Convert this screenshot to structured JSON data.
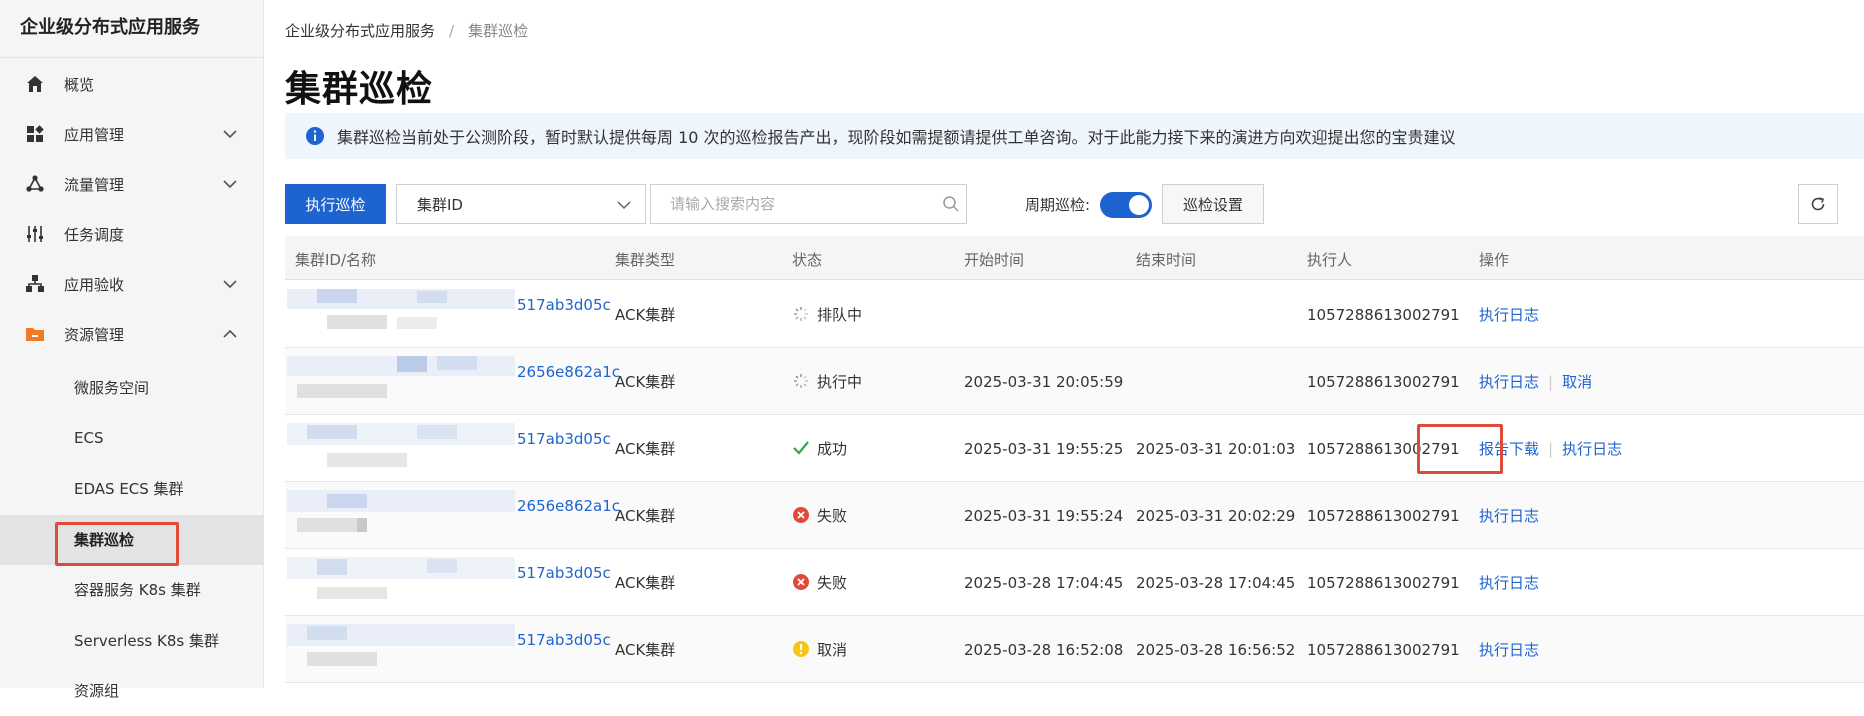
{
  "sidebar": {
    "title": "企业级分布式应用服务",
    "items": [
      {
        "label": "概览",
        "icon": "home-icon"
      },
      {
        "label": "应用管理",
        "icon": "apps-icon",
        "expand": "down"
      },
      {
        "label": "流量管理",
        "icon": "traffic-icon",
        "expand": "down"
      },
      {
        "label": "任务调度",
        "icon": "sliders-icon"
      },
      {
        "label": "应用验收",
        "icon": "acceptance-icon",
        "expand": "down"
      },
      {
        "label": "资源管理",
        "icon": "folder-icon",
        "expand": "up"
      }
    ],
    "subitems": [
      {
        "label": "微服务空间"
      },
      {
        "label": "ECS"
      },
      {
        "label": "EDAS ECS 集群"
      },
      {
        "label": "集群巡检",
        "active": true
      },
      {
        "label": "容器服务 K8s 集群"
      },
      {
        "label": "Serverless K8s 集群"
      },
      {
        "label": "资源组"
      }
    ]
  },
  "breadcrumb": {
    "root": "企业级分布式应用服务",
    "sep": "/",
    "current": "集群巡检"
  },
  "page_title": "集群巡检",
  "notice": "集群巡检当前处于公测阶段，暂时默认提供每周 10 次的巡检报告产出，现阶段如需提额请提供工单咨询。对于此能力接下来的演进方向欢迎提出您的宝贵建议",
  "toolbar": {
    "run_label": "执行巡检",
    "select_value": "集群ID",
    "search_placeholder": "请输入搜索内容",
    "period_label": "周期巡检:",
    "period_on": true,
    "settings_label": "巡检设置"
  },
  "table": {
    "columns": [
      "集群ID/名称",
      "集群类型",
      "状态",
      "开始时间",
      "结束时间",
      "执行人",
      "操作"
    ],
    "rows": [
      {
        "id_suffix": "517ab3d05c",
        "type": "ACK集群",
        "status": "排队中",
        "status_icon": "pending-icon",
        "start": "",
        "end": "",
        "executor": "1057288613002791",
        "ops": [
          "执行日志"
        ]
      },
      {
        "id_suffix": "2656e862a1c",
        "type": "ACK集群",
        "status": "执行中",
        "status_icon": "pending-icon",
        "start": "2025-03-31 20:05:59",
        "end": "",
        "executor": "1057288613002791",
        "ops": [
          "执行日志",
          "取消"
        ]
      },
      {
        "id_suffix": "517ab3d05c",
        "type": "ACK集群",
        "status": "成功",
        "status_icon": "check-icon",
        "start": "2025-03-31 19:55:25",
        "end": "2025-03-31 20:01:03",
        "executor": "1057288613002791",
        "ops": [
          "报告下载",
          "执行日志"
        ]
      },
      {
        "id_suffix": "2656e862a1c",
        "type": "ACK集群",
        "status": "失败",
        "status_icon": "error-icon",
        "start": "2025-03-31 19:55:24",
        "end": "2025-03-31 20:02:29",
        "executor": "1057288613002791",
        "ops": [
          "执行日志"
        ]
      },
      {
        "id_suffix": "517ab3d05c",
        "type": "ACK集群",
        "status": "失败",
        "status_icon": "error-icon",
        "start": "2025-03-28 17:04:45",
        "end": "2025-03-28 17:04:45",
        "executor": "1057288613002791",
        "ops": [
          "执行日志"
        ]
      },
      {
        "id_suffix": "517ab3d05c",
        "type": "ACK集群",
        "status": "取消",
        "status_icon": "warning-icon",
        "start": "2025-03-28 16:52:08",
        "end": "2025-03-28 16:56:52",
        "executor": "1057288613002791",
        "ops": [
          "执行日志"
        ]
      }
    ]
  },
  "colors": {
    "primary": "#1e64d0",
    "highlight": "#e04a3a",
    "success": "#2fa84f",
    "error": "#e04a3a",
    "warning": "#f5c518"
  }
}
